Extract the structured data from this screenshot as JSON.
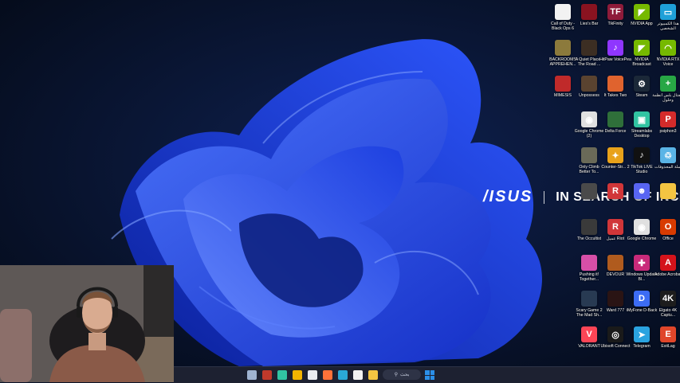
{
  "wallpaper": {
    "brand_logo": "/ISUS",
    "tagline": "IN SEARCH OF INCREDIBLE",
    "colors": {
      "background": "#071127",
      "bloom": "#1e44e8"
    }
  },
  "desktop_icons": [
    {
      "label": "Call of Duty - Black Ops 6",
      "icon": "file-icon",
      "color": "#f2f2f2"
    },
    {
      "label": "Lies's Bar",
      "icon": "game-icon",
      "color": "#8a1320"
    },
    {
      "label": "TikFinity",
      "icon": "tf-icon",
      "color": "#8e1b3a"
    },
    {
      "label": "NVIDIA App",
      "icon": "nvidia-icon",
      "color": "#76b900"
    },
    {
      "label": "هذا الكمبيوتر الشخصي",
      "icon": "monitor-icon",
      "color": "#1fa0d8"
    },
    {
      "label": "BACKROOMS APPREHEN...",
      "icon": "game-icon",
      "color": "#8c7a3c"
    },
    {
      "label": "A Quiet Place - The Road ...",
      "icon": "game-icon",
      "color": "#3c2e23"
    },
    {
      "label": "HitPaw VoicePea",
      "icon": "mic-icon",
      "color": "#8f36ff"
    },
    {
      "label": "NVIDIA Broadcast",
      "icon": "nvidia-icon",
      "color": "#76b900"
    },
    {
      "label": "NVIDIA RTX Voice",
      "icon": "headset-icon",
      "color": "#76b900"
    },
    {
      "label": "MIMESIS",
      "icon": "game-icon",
      "color": "#c02a2a"
    },
    {
      "label": "Unpossess",
      "icon": "game-icon",
      "color": "#5a4330"
    },
    {
      "label": "It Takes Two",
      "icon": "game-icon",
      "color": "#e0632e"
    },
    {
      "label": "Steam",
      "icon": "steam-icon",
      "color": "#1b2838"
    },
    {
      "label": "ديجتال بلس أنظمة وحلول",
      "icon": "logo-icon",
      "color": "#28a745"
    },
    {
      "label": "Google Chrome (2)",
      "icon": "chrome-icon",
      "color": "#e0e0e0"
    },
    {
      "label": "Delta Force",
      "icon": "game-icon",
      "color": "#2f6f3a"
    },
    {
      "label": "Streamlabs Desktop",
      "icon": "streamlabs-icon",
      "color": "#31c3a2"
    },
    {
      "label": "psiphon3",
      "icon": "psiphon-icon",
      "color": "#d42b2b"
    },
    {
      "label": "Only Climb Better To...",
      "icon": "game-icon",
      "color": "#6a6a58"
    },
    {
      "label": "Counter-Str... 2",
      "icon": "cs2-icon",
      "color": "#e8a21a"
    },
    {
      "label": "TikTok LIVE Studio",
      "icon": "tiktok-icon",
      "color": "#111111"
    },
    {
      "label": "سلة المحذوفات",
      "icon": "recycle-bin-icon",
      "color": "#5ab4e6"
    },
    {
      "label": "",
      "icon": "game-icon",
      "color": "#4a4a4a"
    },
    {
      "label": "",
      "icon": "riot-icon",
      "color": "#d13639"
    },
    {
      "label": "",
      "icon": "discord-icon",
      "color": "#5865f2"
    },
    {
      "label": "",
      "icon": "folder-icon",
      "color": "#f4c542"
    },
    {
      "label": "The Occultist",
      "icon": "game-icon",
      "color": "#3a3a3a"
    },
    {
      "label": "عميل Riot",
      "icon": "riot-icon",
      "color": "#d13639"
    },
    {
      "label": "Google Chrome",
      "icon": "chrome-icon",
      "color": "#e0e0e0"
    },
    {
      "label": "Office",
      "icon": "office-icon",
      "color": "#d83b01"
    },
    {
      "label": "Pushing it! Together...",
      "icon": "game-icon",
      "color": "#d74fa8"
    },
    {
      "label": "DEVOUR",
      "icon": "game-icon",
      "color": "#b05b1e"
    },
    {
      "label": "Windows Update Bl...",
      "icon": "shield-icon",
      "color": "#c92a7a"
    },
    {
      "label": "Adobe Acrobat",
      "icon": "acrobat-icon",
      "color": "#d4131b"
    },
    {
      "label": "Scary Game 2 The Mad Sh...",
      "icon": "game-icon",
      "color": "#283a52"
    },
    {
      "label": "Ward 777",
      "icon": "game-icon",
      "color": "#2a1414"
    },
    {
      "label": "iMyFone D-Back",
      "icon": "imyfone-icon",
      "color": "#3c6cf4"
    },
    {
      "label": "Elgato 4K Captu...",
      "icon": "elgato-icon",
      "color": "#1d1d1d"
    },
    {
      "label": "VALORANT",
      "icon": "valorant-icon",
      "color": "#fd4556"
    },
    {
      "label": "Ubisoft Connect",
      "icon": "ubisoft-icon",
      "color": "#1a1a1a"
    },
    {
      "label": "Telegram",
      "icon": "telegram-icon",
      "color": "#2aa3e0"
    },
    {
      "label": "ExitLag",
      "icon": "exitlag-icon",
      "color": "#e0462a"
    }
  ],
  "taskbar": {
    "search_placeholder": "بحث",
    "pinned": [
      {
        "name": "steam-taskbar-icon",
        "color": "#9fb3d1"
      },
      {
        "name": "game-taskbar-icon",
        "color": "#c0392b"
      },
      {
        "name": "streamlabs-taskbar-icon",
        "color": "#31c3a2"
      },
      {
        "name": "chrome-taskbar-icon",
        "color": "#f4b400"
      },
      {
        "name": "file-taskbar-icon",
        "color": "#e8eaf0"
      },
      {
        "name": "firefox-taskbar-icon",
        "color": "#ff7139"
      },
      {
        "name": "edge-taskbar-icon",
        "color": "#2aa9d6"
      },
      {
        "name": "store-taskbar-icon",
        "color": "#f2f2f2"
      },
      {
        "name": "file-explorer-taskbar-icon",
        "color": "#f4c542"
      }
    ],
    "start_color": "#2b8fe8"
  }
}
